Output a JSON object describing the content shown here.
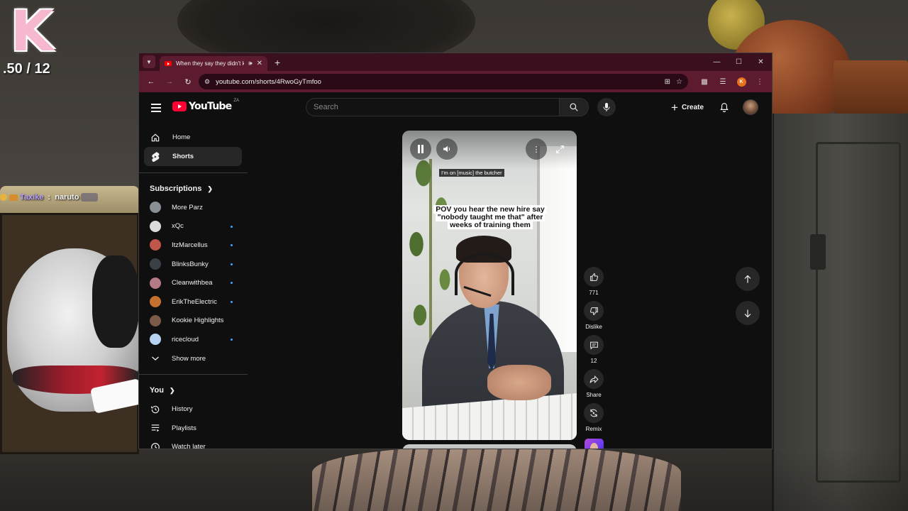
{
  "overlay": {
    "logo_letter": "K",
    "counter": ".50 / 12",
    "chat": {
      "user": "Taxike",
      "separator": " : ",
      "message": "naruto"
    }
  },
  "browser": {
    "tab": {
      "title": "When they say they didn't k"
    },
    "url": "youtube.com/shorts/4RwoGyTmfoo",
    "profile_initial": "K"
  },
  "youtube": {
    "logo_text": "YouTube",
    "country_code": "ZA",
    "search": {
      "placeholder": "Search",
      "value": ""
    },
    "create_label": "Create",
    "nav": [
      {
        "label": "Home",
        "icon": "home-icon",
        "active": false
      },
      {
        "label": "Shorts",
        "icon": "shorts-icon",
        "active": true
      }
    ],
    "subscriptions": {
      "heading": "Subscriptions",
      "items": [
        {
          "name": "More Parz",
          "color": "#8a8f96",
          "new": false
        },
        {
          "name": "xQc",
          "color": "#dcdcdc",
          "new": true
        },
        {
          "name": "ItzMarcellus",
          "color": "#c0554a",
          "new": true
        },
        {
          "name": "BlinksBunky",
          "color": "#3b3f46",
          "new": true
        },
        {
          "name": "Cleanwithbea",
          "color": "#b47a86",
          "new": true
        },
        {
          "name": "ErikTheElectric",
          "color": "#c6702f",
          "new": true
        },
        {
          "name": "Kookie Highlights",
          "color": "#7a5a48",
          "new": false
        },
        {
          "name": "ricecloud",
          "color": "#b7d3ef",
          "new": true
        }
      ],
      "show_more": "Show more"
    },
    "you": {
      "heading": "You",
      "items": [
        {
          "label": "History",
          "icon": "history-icon"
        },
        {
          "label": "Playlists",
          "icon": "playlists-icon"
        },
        {
          "label": "Watch later",
          "icon": "watch-later-icon"
        }
      ]
    },
    "short": {
      "caption_small": "I'm on [music] the butcher",
      "caption_main": "POV you hear the new hire say \"nobody taught me that\" after weeks of training them"
    },
    "actions": {
      "likes": "771",
      "dislike_label": "Dislike",
      "comments": "12",
      "share_label": "Share",
      "remix_label": "Remix"
    }
  }
}
